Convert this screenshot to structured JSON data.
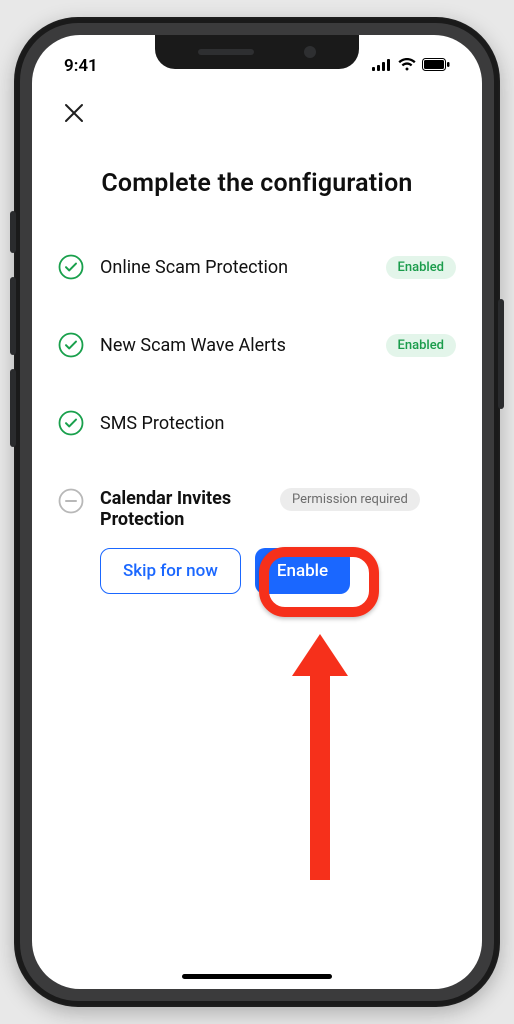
{
  "status": {
    "time": "9:41"
  },
  "title": "Complete the configuration",
  "items": [
    {
      "label": "Online Scam Protection",
      "badge": "Enabled"
    },
    {
      "label": "New Scam Wave Alerts",
      "badge": "Enabled"
    },
    {
      "label": "SMS Protection",
      "badge": ""
    }
  ],
  "pending": {
    "label": "Calendar Invites Protection",
    "badge": "Permission required",
    "skip": "Skip for now",
    "enable": "Enable"
  }
}
